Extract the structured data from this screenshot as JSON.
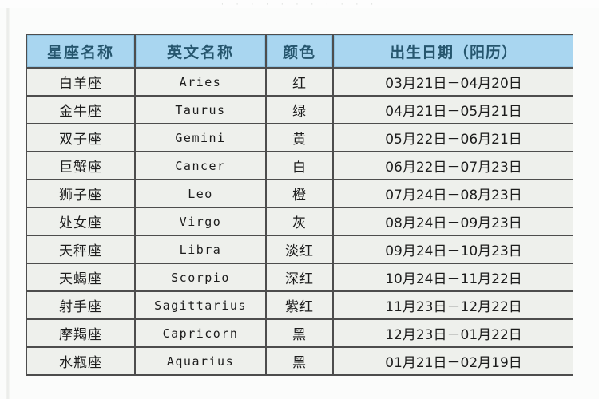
{
  "page": {
    "top_sliver_text": "· · · · ·      · ·      · · · ·"
  },
  "table": {
    "columns": [
      {
        "key": "name",
        "label": "星座名称"
      },
      {
        "key": "en",
        "label": "英文名称"
      },
      {
        "key": "color",
        "label": "颜色"
      },
      {
        "key": "date",
        "label": "出生日期（阳历）"
      }
    ],
    "rows": [
      {
        "name": "白羊座",
        "en": "Aries",
        "color": "红",
        "date": "03月21日－04月20日"
      },
      {
        "name": "金牛座",
        "en": "Taurus",
        "color": "绿",
        "date": "04月21日－05月21日"
      },
      {
        "name": "双子座",
        "en": "Gemini",
        "color": "黄",
        "date": "05月22日－06月21日"
      },
      {
        "name": "巨蟹座",
        "en": "Cancer",
        "color": "白",
        "date": "06月22日－07月23日"
      },
      {
        "name": "狮子座",
        "en": "Leo",
        "color": "橙",
        "date": "07月24日－08月23日"
      },
      {
        "name": "处女座",
        "en": "Virgo",
        "color": "灰",
        "date": "08月24日－09月23日"
      },
      {
        "name": "天秤座",
        "en": "Libra",
        "color": "淡红",
        "date": "09月24日－10月23日"
      },
      {
        "name": "天蝎座",
        "en": "Scorpio",
        "color": "深红",
        "date": "10月24日－11月22日"
      },
      {
        "name": "射手座",
        "en": "Sagittarius",
        "color": "紫红",
        "date": "11月23日－12月22日"
      },
      {
        "name": "摩羯座",
        "en": "Capricorn",
        "color": "黑",
        "date": "12月23日－01月22日"
      },
      {
        "name": "水瓶座",
        "en": "Aquarius",
        "color": "黑",
        "date": "01月21日－02月19日"
      }
    ]
  },
  "colors": {
    "header_bg": "#a9d6f0",
    "header_text": "#26566e",
    "cell_bg": "#eef0ec",
    "cell_text": "#1c1c1c",
    "grid": "#4d4d4d",
    "page_bg": "#fbfcfb"
  }
}
